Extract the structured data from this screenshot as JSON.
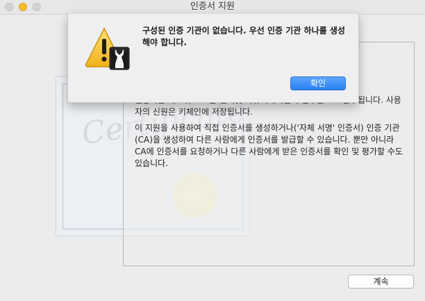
{
  "window": {
    "title": "인증서 지원"
  },
  "sheet": {
    "message": "구성된 인증 기관이 없습니다. 우선 인증 기관 하나를 생성해야 합니다.",
    "ok_label": "확인"
  },
  "content": {
    "paragraph1": "인증서는 네트워크 또는 인터넷 커뮤니케이션의 일부분으로 간주됩니다. 사용자의 신원은 키체인에 저장됩니다.",
    "paragraph2": "이 지원을 사용하여 직접 인증서를 생성하거나('자체 서명' 인증서) 인증 기관(CA)을 생성하여 다른 사람에게 인증서를 발급할 수 있습니다. 뿐만 아니라 CA에 인증서를 요청하거나 다른 사람에게 받은 인증서를 확인 및 평가할 수도 있습니다."
  },
  "footer": {
    "continue_label": "계속"
  },
  "artwork": {
    "certificate_script": "Certificate"
  },
  "colors": {
    "accent": "#2a7ff5",
    "window_bg": "#ececec",
    "minimize_yellow": "#f5bd2f"
  },
  "icons": {
    "alert": "warning-triangle-icon",
    "badge": "tuxedo-badge-icon"
  }
}
